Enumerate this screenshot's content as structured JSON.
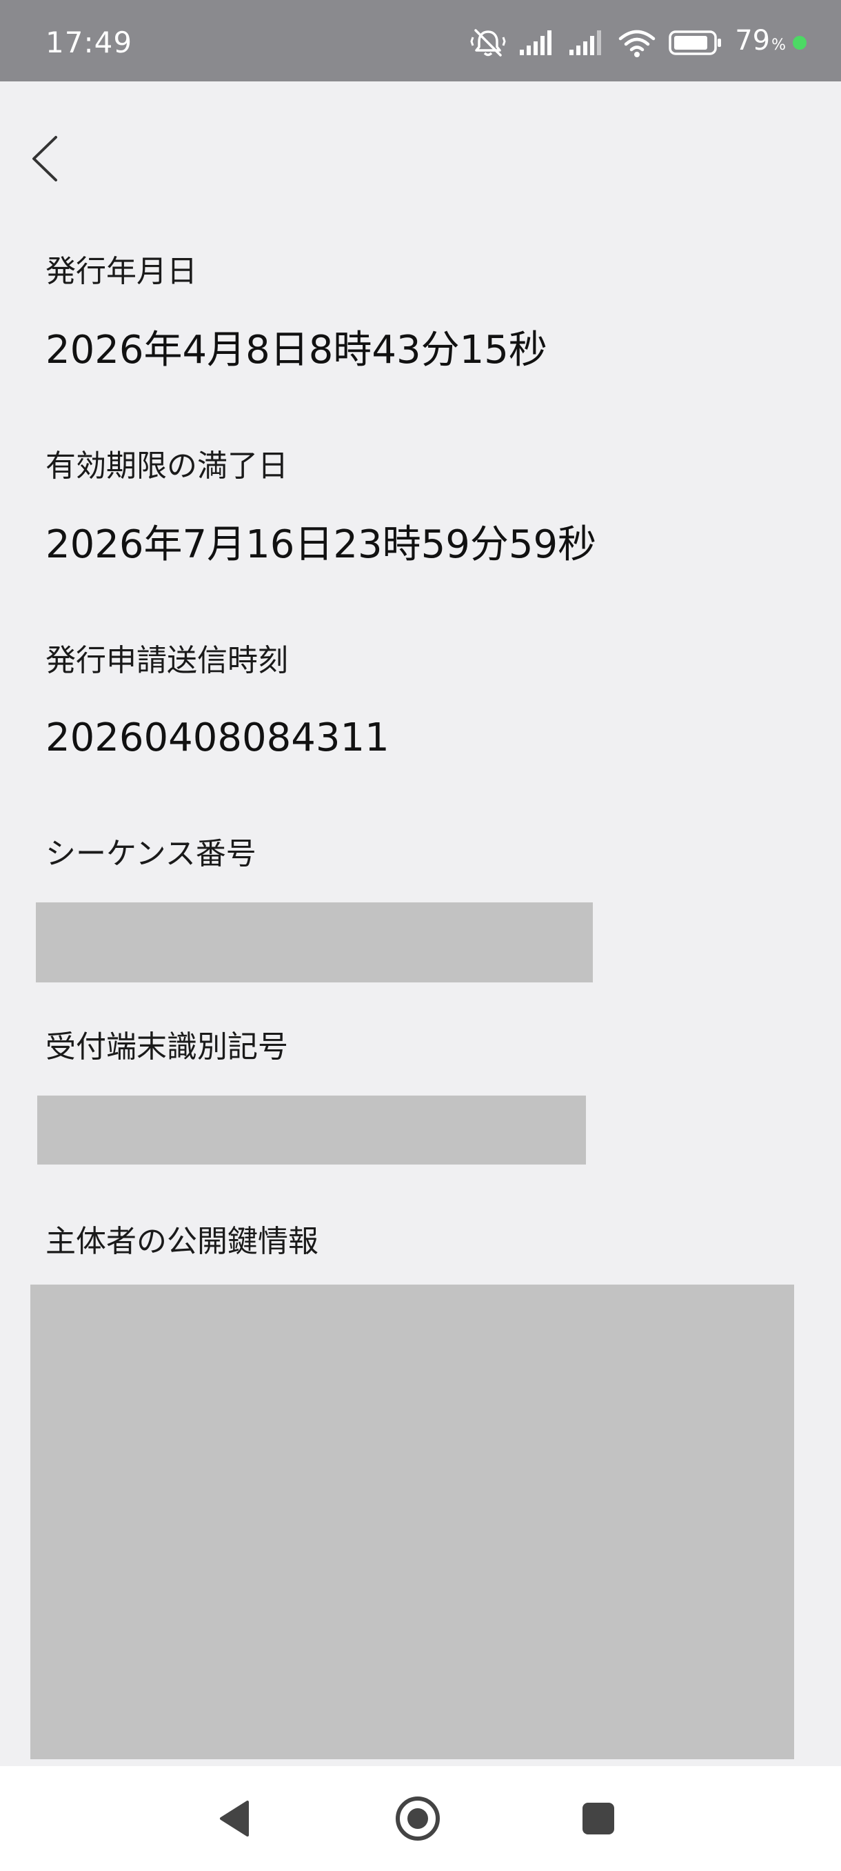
{
  "status_bar": {
    "time": "17:49",
    "battery_percent": "79",
    "battery_unit": "%",
    "icons": [
      "mute-icon",
      "signal-icon",
      "signal-icon",
      "wifi-icon",
      "battery-icon"
    ],
    "charging_dot_color": "#4cd964"
  },
  "header": {
    "back_icon": "chevron-left-icon"
  },
  "fields": {
    "issue_date": {
      "label": "発行年月日",
      "value": "2026年4月8日8時43分15秒"
    },
    "expiry_date": {
      "label": "有効期限の満了日",
      "value": "2026年7月16日23時59分59秒"
    },
    "request_time": {
      "label": "発行申請送信時刻",
      "value": "20260408084311"
    },
    "sequence_number": {
      "label": "シーケンス番号"
    },
    "terminal_id": {
      "label": "受付端末識別記号"
    },
    "public_key": {
      "label": "主体者の公開鍵情報"
    }
  },
  "nav_bar": {
    "icons": [
      "back-triangle-icon",
      "home-circle-icon",
      "recents-square-icon"
    ]
  },
  "colors": {
    "background": "#f0f0f2",
    "status_bar": "#8a8a8e",
    "redacted": "#c2c2c2"
  }
}
